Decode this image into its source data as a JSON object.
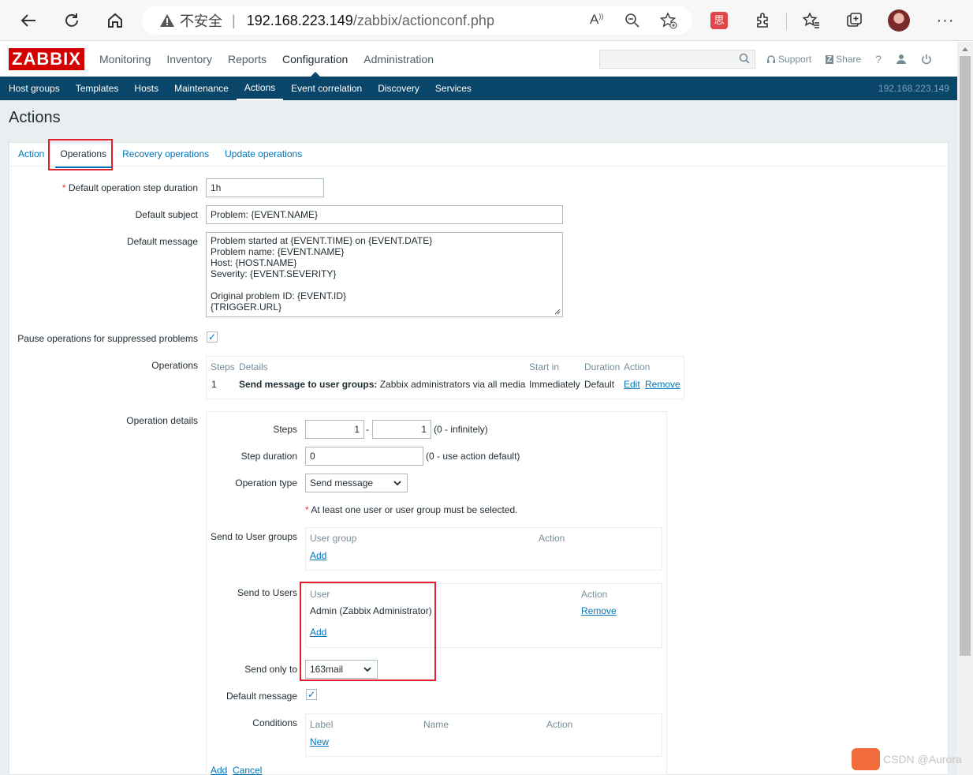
{
  "browser": {
    "security_label": "不安全",
    "url_host": "192.168.223.149",
    "url_path": "/zabbix/actionconf.php"
  },
  "zabbix": {
    "logo": "ZABBIX",
    "top_menu": [
      "Monitoring",
      "Inventory",
      "Reports",
      "Configuration",
      "Administration"
    ],
    "header_links": {
      "support": "Support",
      "share": "Share",
      "help": "?"
    },
    "sub_menu": [
      "Host groups",
      "Templates",
      "Hosts",
      "Maintenance",
      "Actions",
      "Event correlation",
      "Discovery",
      "Services"
    ],
    "server_ip": "192.168.223.149"
  },
  "page": {
    "title": "Actions",
    "tabs": [
      "Action",
      "Operations",
      "Recovery operations",
      "Update operations"
    ]
  },
  "form": {
    "step_duration_label": "Default operation step duration",
    "step_duration_value": "1h",
    "subject_label": "Default subject",
    "subject_value": "Problem: {EVENT.NAME}",
    "message_label": "Default message",
    "message_value": "Problem started at {EVENT.TIME} on {EVENT.DATE}\nProblem name: {EVENT.NAME}\nHost: {HOST.NAME}\nSeverity: {EVENT.SEVERITY}\n\nOriginal problem ID: {EVENT.ID}\n{TRIGGER.URL}",
    "pause_label": "Pause operations for suppressed problems",
    "operations_label": "Operations",
    "operations_table": {
      "headers": [
        "Steps",
        "Details",
        "Start in",
        "Duration",
        "Action"
      ],
      "row": {
        "steps": "1",
        "details_bold": "Send message to user groups:",
        "details_rest": " Zabbix administrators via all media",
        "start_in": "Immediately",
        "duration": "Default",
        "edit": "Edit",
        "remove": "Remove"
      }
    },
    "op_details_label": "Operation details"
  },
  "details": {
    "steps_label": "Steps",
    "steps_from": "1",
    "steps_dash": "-",
    "steps_to": "1",
    "steps_hint": "(0 - infinitely)",
    "step_duration_label": "Step duration",
    "step_duration_value": "0",
    "step_duration_hint": "(0 - use action default)",
    "op_type_label": "Operation type",
    "op_type_value": "Send message",
    "warning": "At least one user or user group must be selected.",
    "user_groups_label": "Send to User groups",
    "user_groups_headers": [
      "User group",
      "Action"
    ],
    "user_groups_add": "Add",
    "users_label": "Send to Users",
    "users_headers": [
      "User",
      "Action"
    ],
    "user_name": "Admin (Zabbix Administrator)",
    "user_remove": "Remove",
    "users_add": "Add",
    "send_only_label": "Send only to",
    "send_only_value": "163mail",
    "default_message_label": "Default message",
    "conditions_label": "Conditions",
    "conditions_headers": [
      "Label",
      "Name",
      "Action"
    ],
    "conditions_new": "New",
    "add": "Add",
    "cancel": "Cancel"
  },
  "watermark": "CSDN @Aurora"
}
